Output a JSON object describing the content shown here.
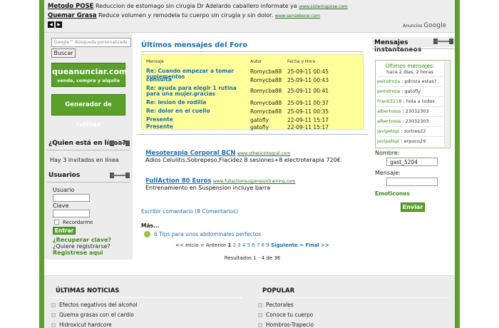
{
  "ads": [
    {
      "title": "Metodo POSE",
      "text": "Reduccion de estomago sin cirugia Dr Adelardo caballero informate ya",
      "url": "www.sistemapose.com"
    },
    {
      "title": "Quemar Grasa",
      "text": "Reduce volumen y remodela tu cuerpo sin cirugía y sin dolor.",
      "url": "www.sensebene.com"
    }
  ],
  "ads_brand": {
    "label": "Anuncios",
    "name": "Google"
  },
  "search": {
    "placeholder": "Google™ Búsqueda personalizada",
    "button": "Buscar"
  },
  "banners": {
    "queanunciar": {
      "title": "queanunciar.com",
      "subtitle": "vende, compra y alquila"
    },
    "rutinas": "Generador de rutinas"
  },
  "online": {
    "title": "¿Quien está en línea?",
    "text": "Hay 3 invitados en línea"
  },
  "login": {
    "title": "Usuarios",
    "user_label": "Usuario",
    "pass_label": "Clave",
    "remember": "Recordarme",
    "submit": "Entrar",
    "recover": "¿Recuperar clave?",
    "register_q": "¿Quiere registrarse?",
    "register": "Registrese aqui"
  },
  "forum": {
    "title": "Últimos mensajes del Foro",
    "columns": [
      "Mensaje",
      "Autor",
      "Fecha y Hora"
    ],
    "rows": [
      {
        "subject": "Re: Cuando empezar a tomar suplementos",
        "author": "Romycba88",
        "date": "25-09-11 00:45"
      },
      {
        "subject": "consulta",
        "author": "Romycba88",
        "date": "25-09-11 00:43"
      },
      {
        "subject": "Re: ayuda para elegir 1 rutina para una mujer.gracias",
        "author": "Romycba88",
        "date": "25-09-11 00:41"
      },
      {
        "subject": "Re: lesion de rodilla",
        "author": "Romycba88",
        "date": "25-09-11 00:37"
      },
      {
        "subject": "Re: dolor en el cuello",
        "author": "Romycba88",
        "date": "25-09-11 00:35"
      },
      {
        "subject": "Presente",
        "author": "gatofly",
        "date": "22-09-11 15:17"
      },
      {
        "subject": "Presente",
        "author": "gatofly",
        "date": "22-09-11 15:17"
      }
    ]
  },
  "sponsored": [
    {
      "title": "Mesoterapia Corporal BCN",
      "url": "www.stheticintegral.com",
      "text": "Adios Celulitis,Sobrepeso,Flacidez 8 sesiones+8 electroterapia 720€"
    },
    {
      "title": "FullAction 80 Euros",
      "url": "www.fullactionsuspensiontraining.com",
      "text": "Entrenamiento en Suspension incluye barra"
    }
  ],
  "comment_link": "Escribir comentario (8 Comentarios)",
  "more": {
    "label": "Más...",
    "item": "6 Tips para unos abdominales perfectos"
  },
  "pager": {
    "prev_nav": "<< Inicio < Anterior",
    "current": "1",
    "pages": "2 3 4 5 6 7 8 9",
    "next_nav": "Siguiente > Final >>",
    "results": "Resultados 1 - 4 de 36"
  },
  "shoutbox": {
    "title": "Mensajes instantaneos",
    "header": "Últimos mensajes:",
    "subheader": "hace 2 días, 2 horas",
    "messages": [
      {
        "name": "peindroza",
        "text": "pdroza estas?"
      },
      {
        "name": "peindroza",
        "text": "gatofly"
      },
      {
        "name": "Frank3218",
        "text": "hola a todos"
      },
      {
        "name": "albertosss",
        "text": "23032303"
      },
      {
        "name": "albertosss",
        "text": "23032303"
      },
      {
        "name": "javipelopi",
        "text": "zortres22"
      },
      {
        "name": "javipelopi",
        "text": "erpoco29"
      }
    ],
    "name_label": "Nombre:",
    "name_value": "gast_5204",
    "message_label": "Mensaje:",
    "emoticons": "Emoticonos",
    "send": "Enviar"
  },
  "news": {
    "title": "ÚLTIMAS NOTICIAS",
    "items": [
      "Efectos negativos del alcohol",
      "Quema grasas con el cardio",
      "Hidroxicut hardcore"
    ]
  },
  "popular": {
    "title": "POPULAR",
    "items": [
      "Pectorales",
      "Conoce tu cuerpo",
      "Hombros-Trapecio"
    ]
  },
  "colors": {
    "accent_green": "#5aa02a",
    "link_blue": "#1a6eb0",
    "forum_bg": "#ffff99"
  }
}
